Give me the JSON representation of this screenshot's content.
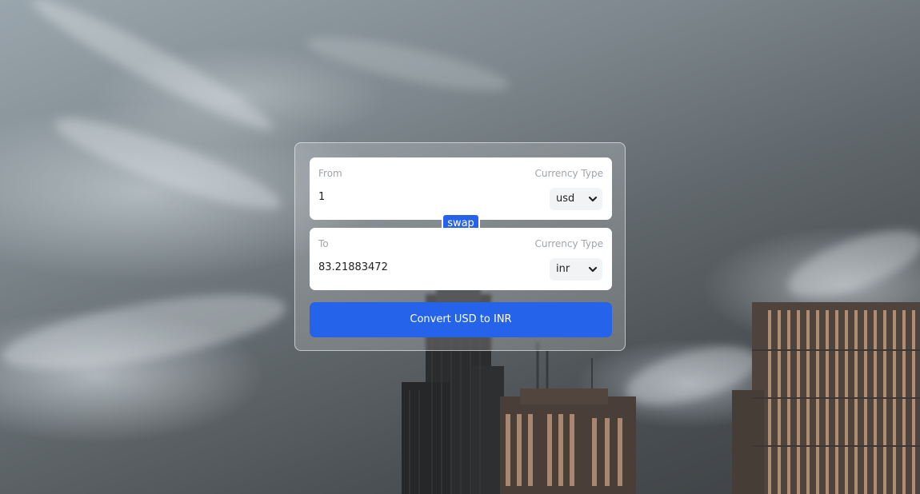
{
  "converter": {
    "from": {
      "label": "From",
      "currency_type_label": "Currency Type",
      "amount": "1",
      "currency": "usd"
    },
    "to": {
      "label": "To",
      "currency_type_label": "Currency Type",
      "amount": "83.21883472",
      "currency": "inr"
    },
    "swap_label": "swap",
    "convert_label": "Convert USD to INR"
  },
  "colors": {
    "accent": "#2563eb",
    "label_gray": "#a0a4a8"
  },
  "icons": {
    "select_chevron": "chevron-down-icon"
  }
}
